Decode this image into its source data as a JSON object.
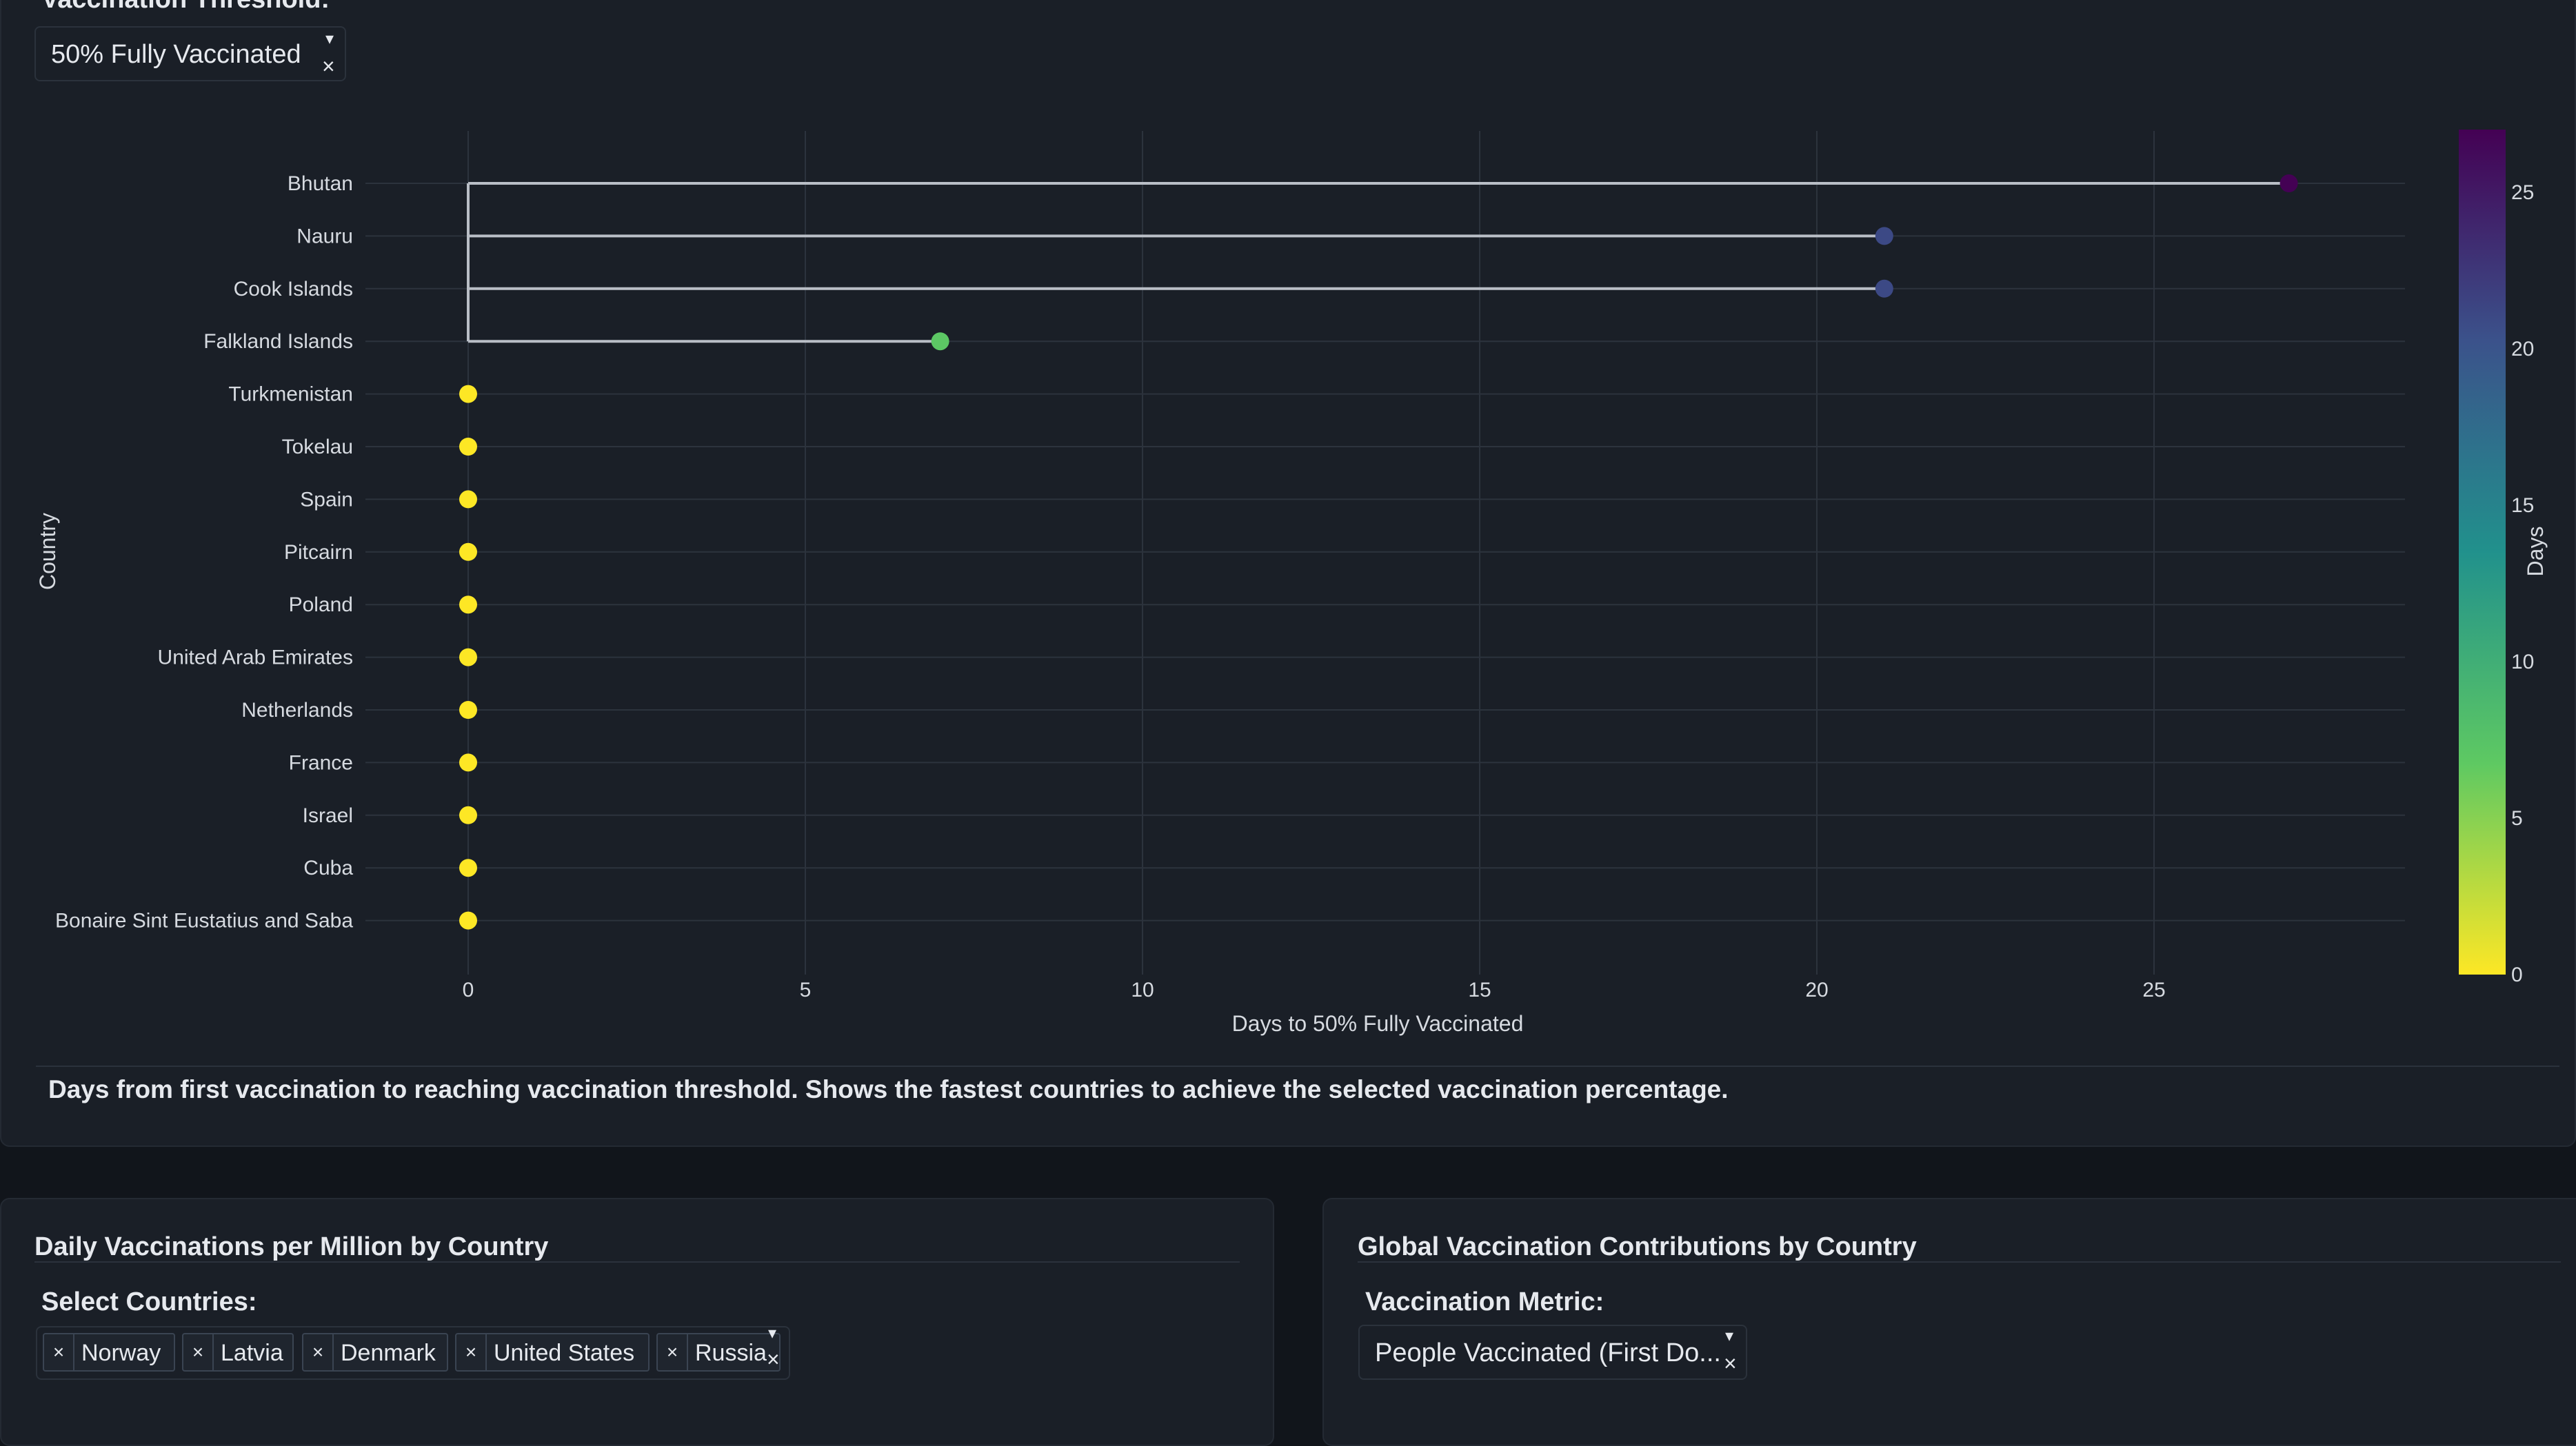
{
  "top_panel": {
    "threshold_label": "Vaccination Threshold:",
    "threshold_value": "50% Fully Vaccinated",
    "caption": "Days from first vaccination to reaching vaccination threshold. Shows the fastest countries to achieve the selected vaccination percentage."
  },
  "chart_data": {
    "type": "scatter",
    "subtype": "lollipop",
    "categories": [
      "Bhutan",
      "Nauru",
      "Cook Islands",
      "Falkland Islands",
      "Turkmenistan",
      "Tokelau",
      "Spain",
      "Pitcairn",
      "Poland",
      "United Arab Emirates",
      "Netherlands",
      "France",
      "Israel",
      "Cuba",
      "Bonaire Sint Eustatius and Saba"
    ],
    "values": [
      27,
      21,
      21,
      7,
      0,
      0,
      0,
      0,
      0,
      0,
      0,
      0,
      0,
      0,
      0
    ],
    "xlabel": "Days to 50% Fully Vaccinated",
    "ylabel": "Country",
    "xlim": [
      -1.2,
      28.5
    ],
    "xticks": [
      0,
      5,
      10,
      15,
      20,
      25
    ],
    "grid": true,
    "colorscale": "viridis (reversed)",
    "colorbar": {
      "title": "Days",
      "range": [
        0,
        27
      ],
      "ticks": [
        0,
        5,
        10,
        15,
        20,
        25
      ]
    },
    "colors": {
      "stem": "#b9bec6",
      "grid": "#2c333d"
    }
  },
  "daily_panel": {
    "title": "Daily Vaccinations per Million by Country",
    "select_label": "Select Countries:",
    "selected": [
      "Norway",
      "Latvia",
      "Denmark",
      "United States",
      "Russia"
    ],
    "remove_glyph": "×",
    "arrow_glyph": "▾",
    "clear_glyph": "×"
  },
  "global_panel": {
    "title": "Global Vaccination Contributions by Country",
    "metric_label": "Vaccination Metric:",
    "metric_value": "People Vaccinated (First Do..."
  }
}
